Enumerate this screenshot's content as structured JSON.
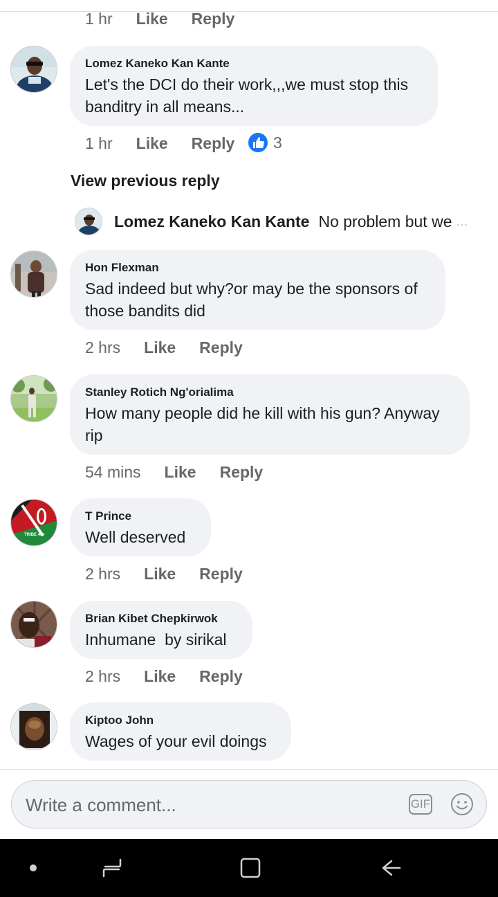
{
  "comments": [
    {
      "time": "1 hr",
      "like": "Like",
      "reply": "Reply"
    },
    {
      "name": "Lomez Kaneko Kan Kante",
      "text_line1": "Let's the DCI do their work,,,we must stop this",
      "text_line2": "banditry in all means...",
      "time": "1 hr",
      "like": "Like",
      "reply": "Reply",
      "reaction_count": "3"
    },
    {
      "name": "Hon Flexman",
      "text_line1": "Sad indeed but why?or may be the sponsors of",
      "text_line2": "those bandits did",
      "time": "2 hrs",
      "like": "Like",
      "reply": "Reply"
    },
    {
      "name": "Stanley Rotich Ng'orialima",
      "text_line1": "How many people did he kill with his gun? Anyway",
      "text_line2": "rip",
      "time": "54 mins",
      "like": "Like",
      "reply": "Reply"
    },
    {
      "name": "T Prince",
      "text_line1": "Well deserved",
      "time": "2 hrs",
      "like": "Like",
      "reply": "Reply",
      "avatar_text": "TRIBE 43+"
    },
    {
      "name": "Brian Kibet Chepkirwok",
      "text_line1": "Inhumane  by sirikal",
      "time": "2 hrs",
      "like": "Like",
      "reply": "Reply"
    },
    {
      "name": "Kiptoo John",
      "text_line1": "Wages of your evil doings"
    }
  ],
  "view_previous_reply": "View previous reply",
  "reply_preview": {
    "name": "Lomez Kaneko Kan Kante",
    "text": "No problem but we",
    "ellipsis": "..."
  },
  "composer": {
    "placeholder": "Write a comment...",
    "gif_label": "GIF"
  },
  "colors": {
    "bubble": "#f0f2f5",
    "meta_text": "#65676b",
    "like_blue": "#1877f2",
    "navbar": "#000000"
  }
}
